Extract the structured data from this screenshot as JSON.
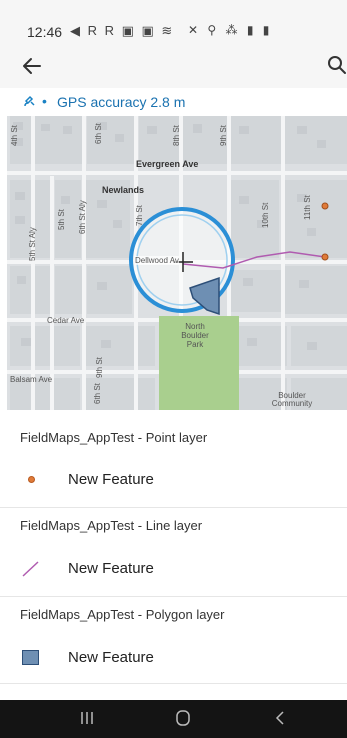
{
  "status_bar": {
    "time": "12:46",
    "left_icons": "◀ R R ▣ ▣ ≋",
    "right_icons": "✕ ⚲ ⁂ ▮ ▮"
  },
  "app_bar": {
    "back_icon": "arrow-left",
    "search_icon": "search"
  },
  "gps": {
    "icon": "satellite",
    "separator": "•",
    "text": "GPS accuracy 2.8 m"
  },
  "map": {
    "labels": {
      "evergreen": "Evergreen Ave",
      "newlands": "Newlands",
      "dellwood": "Dellwood Av",
      "cedar": "Cedar Ave",
      "north_boulder_park": "North Boulder Park",
      "balsam": "Balsam Ave",
      "boulder_community": "Boulder Community",
      "st_4th": "4th St",
      "st_6th": "6th St",
      "st_8th": "8th St",
      "st_9th": "9th St",
      "st_5th_aly": "5th St Aly",
      "st_5th": "5th St",
      "st_6th_aly": "6th St Aly",
      "st_7th": "7th St",
      "st_10th": "10th St",
      "st_11th": "11th St",
      "st_6th_bottom": "6th St",
      "st_9th_bottom": "9th St"
    },
    "colors": {
      "park": "#a9cf8e",
      "accuracy_ring": "#2b8fd6",
      "polygon": "#6e8fb3",
      "line": "#b05bb0",
      "point": "#e07b39"
    }
  },
  "layers": [
    {
      "header": "FieldMaps_AppTest - Point layer",
      "feature": "New Feature",
      "swatch": "point"
    },
    {
      "header": "FieldMaps_AppTest - Line layer",
      "feature": "New Feature",
      "swatch": "line"
    },
    {
      "header": "FieldMaps_AppTest - Polygon layer",
      "feature": "New Feature",
      "swatch": "polygon"
    }
  ],
  "nav_bar": {
    "recents_icon": "recents",
    "home_icon": "home",
    "back_icon": "back"
  }
}
